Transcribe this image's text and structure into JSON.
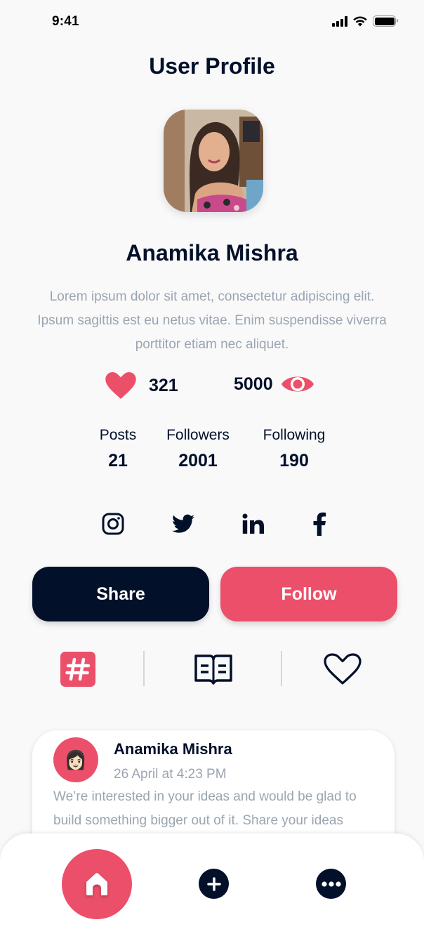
{
  "status_bar": {
    "time": "9:41",
    "icons": [
      "cellular-signal-icon",
      "wifi-icon",
      "battery-icon"
    ]
  },
  "header": {
    "title": "User Profile"
  },
  "profile": {
    "name": "Anamika Mishra",
    "bio": "Lorem ipsum dolor sit amet, consectetur adipiscing elit. Ipsum sagittis est eu netus vitae. Enim suspendisse viverra porttitor etiam nec aliquet.",
    "likes": "321",
    "views": "5000",
    "counts": [
      {
        "label": "Posts",
        "value": "21"
      },
      {
        "label": "Followers",
        "value": "2001"
      },
      {
        "label": "Following",
        "value": "190"
      }
    ]
  },
  "socials": [
    {
      "name": "instagram",
      "icon": "instagram-icon"
    },
    {
      "name": "twitter",
      "icon": "twitter-icon"
    },
    {
      "name": "linkedin",
      "icon": "linkedin-icon"
    },
    {
      "name": "facebook",
      "icon": "facebook-icon"
    }
  ],
  "actions": {
    "share_label": "Share",
    "follow_label": "Follow"
  },
  "tabs": [
    {
      "name": "hashtag",
      "icon": "hashtag-icon",
      "active": true
    },
    {
      "name": "book",
      "icon": "book-icon",
      "active": false
    },
    {
      "name": "favorites",
      "icon": "heart-outline-icon",
      "active": false
    }
  ],
  "post": {
    "author": "Anamika Mishra",
    "avatar_emoji": "👩🏻",
    "timestamp": "26 April at 4:23 PM",
    "text": "We’re interested in your ideas and would be glad to build something bigger out of it. Share your ideas"
  },
  "bottom_nav": [
    {
      "name": "home",
      "icon": "home-icon",
      "active": true
    },
    {
      "name": "add",
      "icon": "plus-icon",
      "active": false
    },
    {
      "name": "more",
      "icon": "more-icon",
      "active": false
    }
  ],
  "colors": {
    "accent": "#ec4f6a",
    "dark": "#03102a",
    "muted_text": "#9aa5b1",
    "background": "#f9f9fa"
  }
}
